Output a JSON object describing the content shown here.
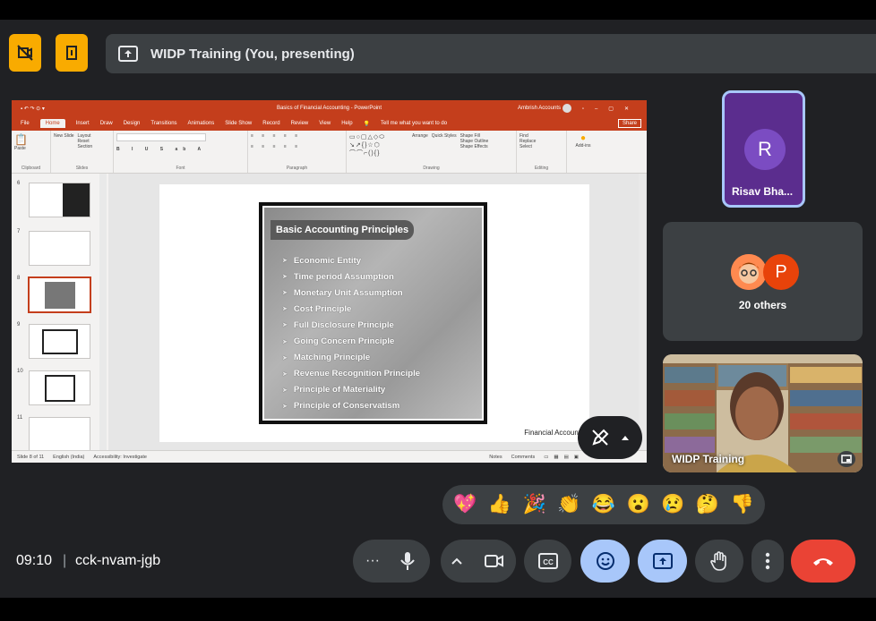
{
  "top_buttons": [
    {
      "name": "no-video-recording-icon"
    },
    {
      "name": "door-exit-icon"
    }
  ],
  "banner": {
    "title": "WIDP Training (You, presenting)",
    "icon": "present-screen-icon"
  },
  "ppt": {
    "title": "Basics of Financial Accounting - PowerPoint",
    "user": "Ambrish Accounts",
    "tabs": [
      "File",
      "Home",
      "Insert",
      "Draw",
      "Design",
      "Transitions",
      "Animations",
      "Slide Show",
      "Record",
      "Review",
      "View",
      "Help"
    ],
    "tell_me": "Tell me what you want to do",
    "share": "Share",
    "ribbon_groups": [
      "Clipboard",
      "Slides",
      "Font",
      "Paragraph",
      "Drawing",
      "Editing",
      "Add-ins"
    ],
    "ribbon_buttons": {
      "paste": "Paste",
      "new_slide": "New Slide",
      "layout": "Layout",
      "reset": "Reset",
      "section": "Section",
      "arrange": "Arrange",
      "quick_styles": "Quick Styles",
      "shape_fill": "Shape Fill",
      "shape_outline": "Shape Outline",
      "shape_effects": "Shape Effects",
      "find": "Find",
      "replace": "Replace",
      "select": "Select",
      "addins": "Add-ins"
    },
    "thumb_numbers": [
      "6",
      "7",
      "8",
      "9",
      "10",
      "11"
    ],
    "slide": {
      "title": "Basic Accounting Principles",
      "items": [
        "Economic Entity",
        "Time period Assumption",
        "Monetary Unit Assumption",
        "Cost Principle",
        "Full Disclosure Principle",
        "Going Concern Principle",
        "Matching Principle",
        "Revenue Recognition Principle",
        "Principle of Materiality",
        "Principle of Conservatism"
      ],
      "footer": "Financial Account"
    },
    "status": {
      "slide": "Slide 8 of 11",
      "lang": "English (India)",
      "access": "Accessibility: Investigate",
      "notes": "Notes",
      "comments": "Comments"
    }
  },
  "participants": {
    "r_tile": {
      "initial": "R",
      "name": "Risav Bha..."
    },
    "others": {
      "label": "20 others",
      "avatar_p": "P"
    },
    "cam": {
      "name": "WIDP Training"
    }
  },
  "reactions": [
    "💖",
    "👍",
    "🎉",
    "👏",
    "😂",
    "😮",
    "😢",
    "🤔",
    "👎"
  ],
  "bottom": {
    "time": "09:10",
    "separator": "|",
    "code": "cck-nvam-jgb"
  },
  "colors": {
    "accent_blue": "#a8c7fa",
    "end_call_red": "#ea4335",
    "warning_yellow": "#f9ab00",
    "ppt_orange": "#c43e1c"
  }
}
